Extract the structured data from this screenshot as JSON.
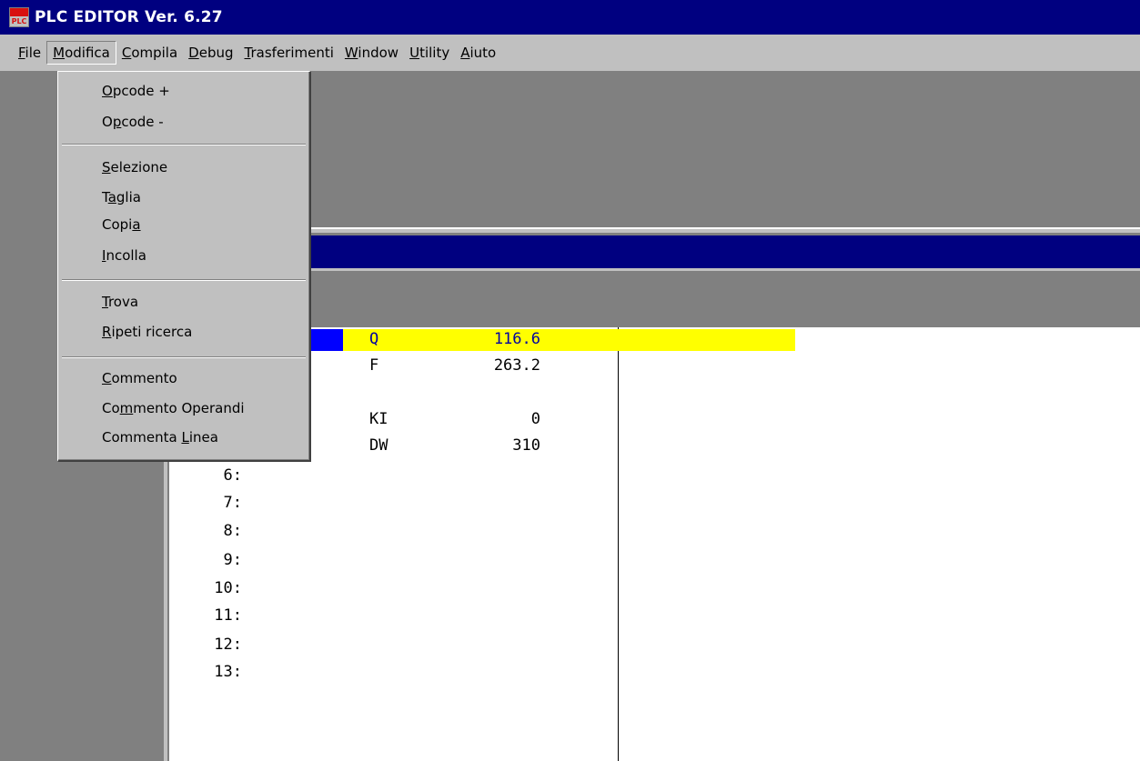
{
  "window": {
    "title": "PLC EDITOR Ver. 6.27",
    "icon": "plc-app-icon",
    "icon_text": "PLC"
  },
  "menubar": {
    "items": [
      {
        "label": "File",
        "mnemonic_index": 0
      },
      {
        "label": "Modifica",
        "mnemonic_index": 0,
        "open": true
      },
      {
        "label": "Compila",
        "mnemonic_index": 0
      },
      {
        "label": "Debug",
        "mnemonic_index": 0
      },
      {
        "label": "Trasferimenti",
        "mnemonic_index": 0
      },
      {
        "label": "Window",
        "mnemonic_index": 0
      },
      {
        "label": "Utility",
        "mnemonic_index": 0
      },
      {
        "label": "Aiuto",
        "mnemonic_index": 0
      }
    ]
  },
  "dropdown": {
    "groups": [
      [
        {
          "label": "Opcode +",
          "mnemonic_index": 0
        },
        {
          "label": "Opcode -",
          "mnemonic_index": 1
        }
      ],
      [
        {
          "label": "Selezione",
          "mnemonic_index": 0
        },
        {
          "label": "Taglia",
          "mnemonic_index": 1
        },
        {
          "label": "Copia",
          "mnemonic_index": 4
        },
        {
          "label": "Incolla",
          "mnemonic_index": 0
        }
      ],
      [
        {
          "label": "Trova",
          "mnemonic_index": 0
        },
        {
          "label": "Ripeti ricerca",
          "mnemonic_index": 0
        }
      ],
      [
        {
          "label": "Commento",
          "mnemonic_index": 0
        },
        {
          "label": "Commento Operandi",
          "mnemonic_index": 2
        },
        {
          "label": "Commenta Linea",
          "mnemonic_index": 9
        }
      ]
    ]
  },
  "editor": {
    "rows": [
      {
        "num": "",
        "opcode": "Q",
        "operand": "116.6",
        "selected": true
      },
      {
        "num": "",
        "opcode": "F",
        "operand": "263.2"
      },
      {
        "num": "",
        "opcode": "",
        "operand": ""
      },
      {
        "num": "",
        "opcode": "KI",
        "operand": "0"
      },
      {
        "num": "",
        "opcode": "DW",
        "operand": "310"
      },
      {
        "num": "6:",
        "opcode": "",
        "operand": ""
      },
      {
        "num": "7:",
        "opcode": "",
        "operand": ""
      },
      {
        "num": "8:",
        "opcode": "",
        "operand": ""
      },
      {
        "num": "9:",
        "opcode": "",
        "operand": ""
      },
      {
        "num": "10:",
        "opcode": "",
        "operand": ""
      },
      {
        "num": "11:",
        "opcode": "",
        "operand": ""
      },
      {
        "num": "12:",
        "opcode": "",
        "operand": ""
      },
      {
        "num": "13:",
        "opcode": "",
        "operand": ""
      }
    ]
  },
  "colors": {
    "titlebar": "#000080",
    "selection_yellow": "#ffff00",
    "selection_blue": "#0000ff",
    "selected_text": "#0000a0",
    "menu_face": "#c0c0c0",
    "workspace": "#808080"
  }
}
